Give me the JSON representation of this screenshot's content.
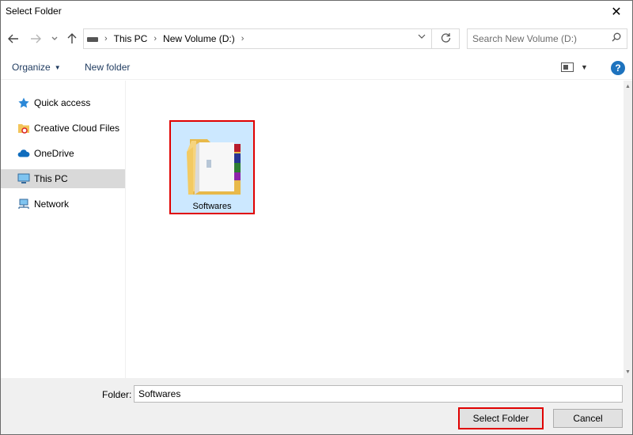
{
  "window": {
    "title": "Select Folder",
    "close_glyph": "✕"
  },
  "nav": {
    "back_icon": "arrow-left-icon",
    "forward_icon": "arrow-right-icon",
    "up_icon": "arrow-up-icon",
    "breadcrumb": [
      "This PC",
      "New Volume (D:)"
    ],
    "search_placeholder": "Search New Volume (D:)"
  },
  "toolbar": {
    "organize_label": "Organize",
    "new_folder_label": "New folder"
  },
  "sidebar": {
    "items": [
      {
        "label": "Quick access",
        "icon": "star-icon"
      },
      {
        "label": "Creative Cloud Files",
        "icon": "creative-cloud-folder-icon"
      },
      {
        "label": "OneDrive",
        "icon": "cloud-icon"
      },
      {
        "label": "This PC",
        "icon": "computer-icon",
        "selected": true
      },
      {
        "label": "Network",
        "icon": "network-icon"
      }
    ]
  },
  "content": {
    "items": [
      {
        "name": "Softwares",
        "type": "folder",
        "selected": true
      }
    ]
  },
  "footer": {
    "folder_label": "Folder:",
    "folder_value": "Softwares",
    "select_label": "Select Folder",
    "cancel_label": "Cancel"
  },
  "colors": {
    "selection": "#cce8ff",
    "highlight_box": "#e00000",
    "accent": "#1e73be"
  }
}
